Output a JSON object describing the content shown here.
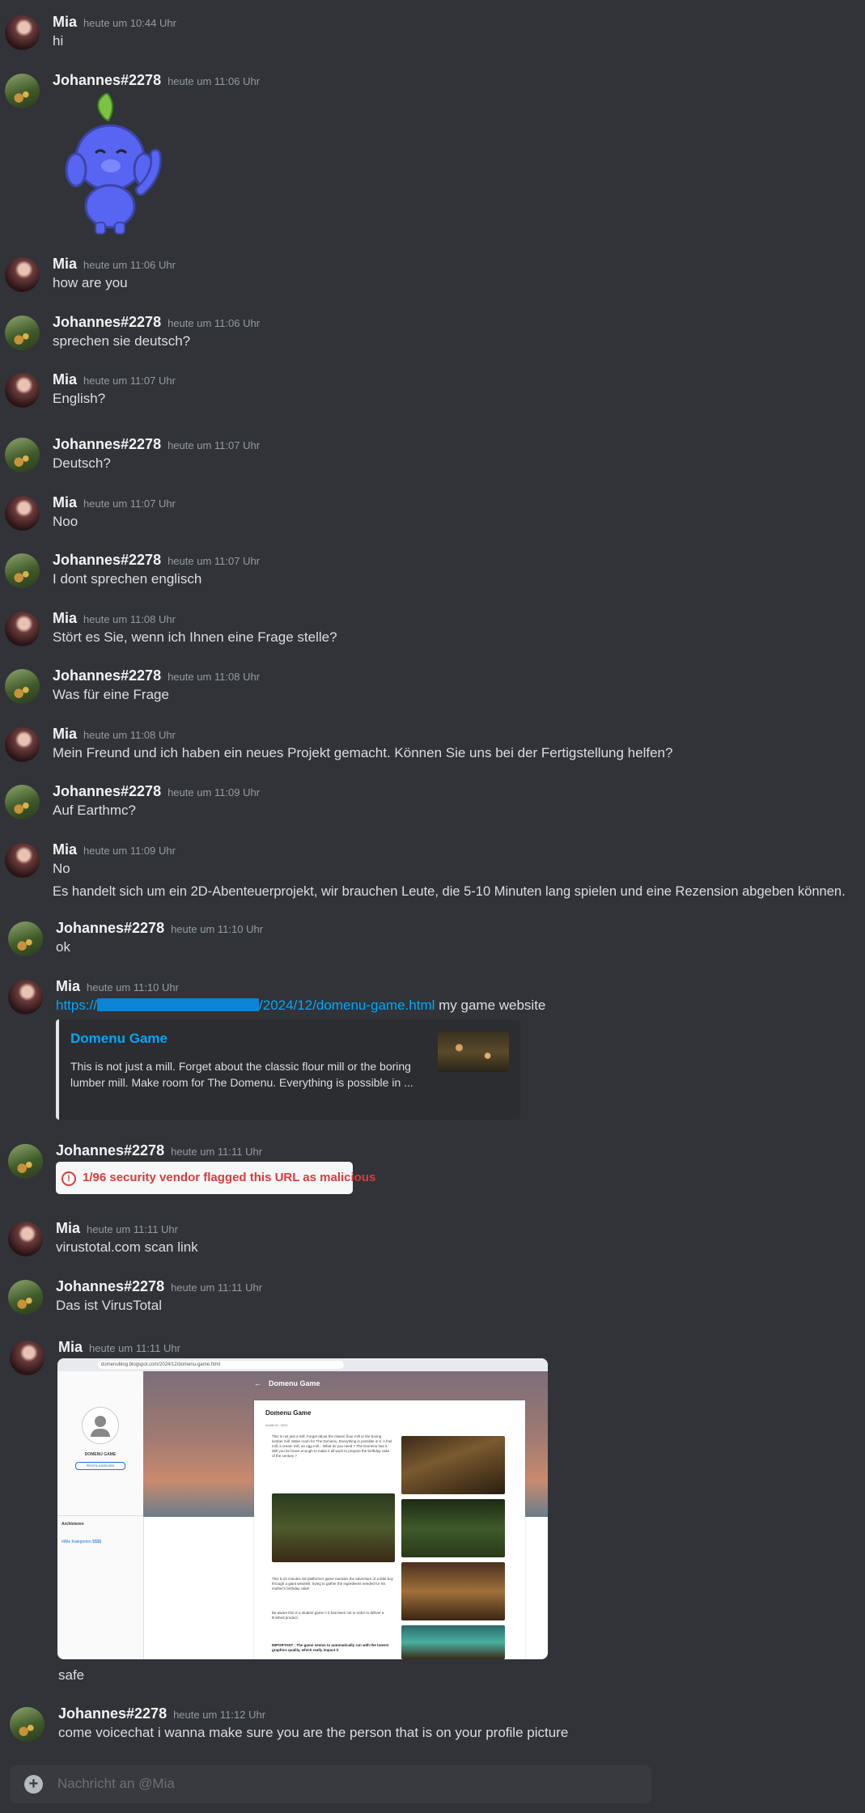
{
  "messages": [
    {
      "author": "Mia",
      "time": "heute um 10:44 Uhr",
      "lines": [
        "hi"
      ]
    },
    {
      "author": "Johannes#2278",
      "time": "heute um 11:06 Uhr",
      "lines": []
    },
    {
      "author": "Mia",
      "time": "heute um 11:06 Uhr",
      "lines": [
        "how are you"
      ]
    },
    {
      "author": "Johannes#2278",
      "time": "heute um 11:06 Uhr",
      "lines": [
        "sprechen sie deutsch?"
      ]
    },
    {
      "author": "Mia",
      "time": "heute um 11:07 Uhr",
      "lines": [
        "English?"
      ]
    },
    {
      "author": "Johannes#2278",
      "time": "heute um 11:07 Uhr",
      "lines": [
        "Deutsch?"
      ]
    },
    {
      "author": "Mia",
      "time": "heute um 11:07 Uhr",
      "lines": [
        "Noo"
      ]
    },
    {
      "author": "Johannes#2278",
      "time": "heute um 11:07 Uhr",
      "lines": [
        "I dont sprechen englisch"
      ]
    },
    {
      "author": "Mia",
      "time": "heute um 11:08 Uhr",
      "lines": [
        "Stört es Sie, wenn ich Ihnen eine Frage stelle?"
      ]
    },
    {
      "author": "Johannes#2278",
      "time": "heute um 11:08 Uhr",
      "lines": [
        "Was für eine Frage"
      ]
    },
    {
      "author": "Mia",
      "time": "heute um 11:08 Uhr",
      "lines": [
        "Mein Freund und ich haben ein neues Projekt gemacht. Können Sie uns bei der Fertigstellung helfen?"
      ]
    },
    {
      "author": "Johannes#2278",
      "time": "heute um 11:09 Uhr",
      "lines": [
        "Auf Earthmc?"
      ]
    },
    {
      "author": "Mia",
      "time": "heute um 11:09 Uhr",
      "lines": [
        "No",
        "Es handelt sich um ein 2D-Abenteuerprojekt, wir brauchen Leute, die 5-10 Minuten lang spielen und eine Rezension abgeben können."
      ]
    },
    {
      "author": "Johannes#2278",
      "time": "heute um 11:10 Uhr",
      "lines": [
        "ok"
      ]
    },
    {
      "author": "Mia",
      "time": "heute um 11:10 Uhr",
      "link_prefix": "https://",
      "link_suffix": "/2024/12/domenu-game.html",
      "link_after": " my game website",
      "embed": {
        "title": "Domenu Game",
        "description": "This is not just a mill. Forget about the classic flour mill or the boring lumber mill. Make room for The Domenu. Everything is possible in ..."
      }
    },
    {
      "author": "Johannes#2278",
      "time": "heute um 11:11 Uhr",
      "virustotal": "1/96 security vendor flagged this URL as malicious"
    },
    {
      "author": "Mia",
      "time": "heute um 11:11 Uhr",
      "lines": [
        "virustotal.com scan link"
      ]
    },
    {
      "author": "Johannes#2278",
      "time": "heute um 11:11 Uhr",
      "lines": [
        "Das ist VirusTotal"
      ]
    },
    {
      "author": "Mia",
      "time": "heute um 11:11 Uhr",
      "lines": [
        "safe"
      ]
    },
    {
      "author": "Johannes#2278",
      "time": "heute um 11:12 Uhr",
      "lines": [
        "come voicechat i wanna make sure you are the person that is on your profile picture"
      ]
    }
  ],
  "screenshot": {
    "page_title": "Domenu Game",
    "post_title": "Domenu Game",
    "post_date": "Avalie 02, 2024",
    "profile_label": "DOMENU GAME",
    "profile_button": "PROFIL ANSEHEN",
    "archive_label": "Archivieren",
    "archive_item": "#Alle Kategorien $$$$",
    "url": "domenublog.blogspot.com/2024/12/domenu-game.html",
    "para1": "This is not just a mill. Forget about the classic flour mill or the boring lumber mill. Make room for The Domenu. Everything is possible in it. A fruit mill, a cream mill, an egg mill... What do you need ? The Domenu has it. Will you be brave enough to make it all work to prepare the birthday cake of the century ?",
    "para2": "This 5-10 minutes 2D platformer game narrates the adventure of a little boy through a giant windmill, trying to gather the ingredients needed for his mother's birthday cake!",
    "para3": "Be aware this is a student game !! It has been cut in order to deliver a finished product.",
    "para4": "IMPORTANT : The game seems to automatically run with the lowest graphics quality, which really impact it"
  },
  "composer": {
    "placeholder": "Nachricht an @Mia"
  }
}
